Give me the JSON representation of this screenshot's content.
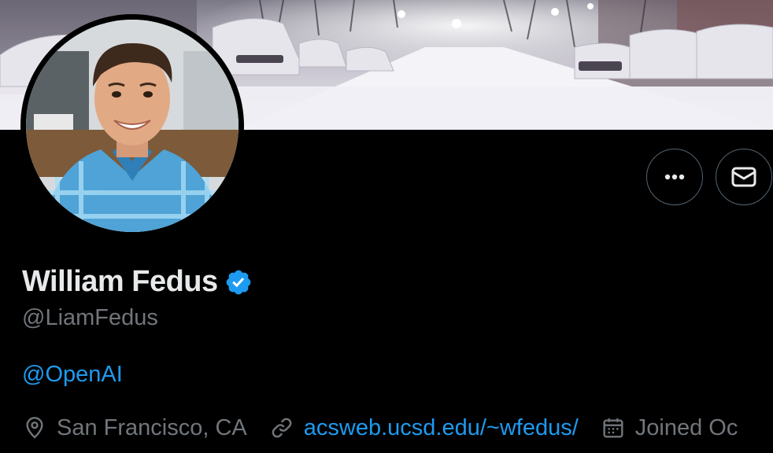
{
  "profile": {
    "display_name": "William Fedus",
    "handle": "@LiamFedus",
    "bio_link": "@OpenAI",
    "location": "San Francisco, CA",
    "website": "acsweb.ucsd.edu/~wfedus/",
    "joined": "Joined Oc"
  },
  "icons": {
    "verified": "verified-badge-icon",
    "more": "more-icon",
    "message": "mail-icon",
    "location": "location-pin-icon",
    "link": "link-icon",
    "calendar": "calendar-icon"
  },
  "colors": {
    "background": "#000000",
    "text_primary": "#e7e9ea",
    "text_secondary": "#71767b",
    "link": "#1d9bf0",
    "button_border": "#536471"
  }
}
